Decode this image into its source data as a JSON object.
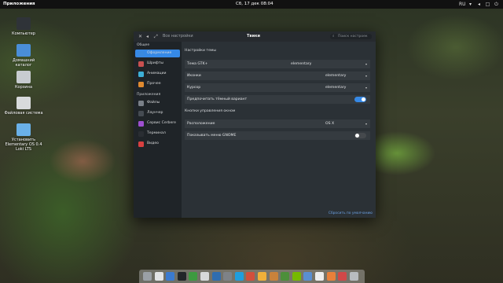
{
  "panel": {
    "applications_label": "Приложения",
    "clock": "Сб, 17 дек  08:04",
    "indicators": [
      {
        "name": "keyboard-layout-icon",
        "text": "RU"
      },
      {
        "name": "network-icon",
        "text": "▾"
      },
      {
        "name": "volume-icon",
        "text": "◂"
      },
      {
        "name": "notifications-icon",
        "text": "□"
      },
      {
        "name": "power-icon",
        "text": "⏻"
      }
    ]
  },
  "desktop": {
    "icons": [
      {
        "name": "computer",
        "label": "Компьютер",
        "color": "#2f3338"
      },
      {
        "name": "home-folder",
        "label": "Домашний каталог",
        "color": "#4a8ed8"
      },
      {
        "name": "trash",
        "label": "Корзина",
        "color": "#c8ccd0"
      },
      {
        "name": "filesystem",
        "label": "Файловая система",
        "color": "#d8dadc"
      },
      {
        "name": "installer",
        "label": "Установить Elementary OS 0.4 Loki LTS",
        "color": "#6ab0e8"
      }
    ]
  },
  "window": {
    "breadcrumb": "Все настройки",
    "title": "Твики",
    "search_placeholder": "Поиск настроек",
    "restore_link": "Сбросить по умолчанию"
  },
  "sidebar": {
    "groups": [
      {
        "label": "Общее",
        "items": [
          {
            "label": "Оформление",
            "icon": "appearance-icon",
            "color": "#3a8ae0",
            "selected": true
          },
          {
            "label": "Шрифты",
            "icon": "fonts-icon",
            "color": "#c85050"
          },
          {
            "label": "Анимации",
            "icon": "animations-icon",
            "color": "#3db0d8"
          },
          {
            "label": "Прочее",
            "icon": "misc-icon",
            "color": "#e08a30"
          }
        ]
      },
      {
        "label": "Приложения",
        "items": [
          {
            "label": "Файлы",
            "icon": "files-icon",
            "color": "#7a8088"
          },
          {
            "label": "Лаунчер",
            "icon": "launcher-icon",
            "color": "#454b52"
          },
          {
            "label": "Сервис Cerbere",
            "icon": "cerbere-icon",
            "color": "#9e4fd0"
          },
          {
            "label": "Терминал",
            "icon": "terminal-icon",
            "color": "#2a2e33"
          },
          {
            "label": "Видео",
            "icon": "videos-icon",
            "color": "#d84040"
          }
        ]
      }
    ]
  },
  "theme_settings": {
    "section_title": "Настройки темы",
    "rows": [
      {
        "label": "Тема GTK+",
        "value": "elementary"
      },
      {
        "label": "Иконки",
        "value": "elementary"
      },
      {
        "label": "Курсор",
        "value": "elementary"
      }
    ],
    "dark_variant": {
      "label": "Предпочитать тёмный вариант",
      "on": true
    }
  },
  "window_controls": {
    "section_title": "Кнопки управления окном",
    "layout": {
      "label": "Расположение",
      "value": "OS X"
    },
    "gnome_menu": {
      "label": "Показывать меню GNOME",
      "on": false
    }
  },
  "colors": {
    "accent": "#3689e6",
    "toggle_off": "#45494d"
  },
  "dock": {
    "items": [
      {
        "name": "files",
        "color": "#9aa0a6"
      },
      {
        "name": "appcenter",
        "color": "#e2e4e6"
      },
      {
        "name": "system-monitor",
        "color": "#3a7ad0"
      },
      {
        "name": "terminal",
        "color": "#222629"
      },
      {
        "name": "code-editor",
        "color": "#3d9a40"
      },
      {
        "name": "screenshot",
        "color": "#d7d9db"
      },
      {
        "name": "web-browser",
        "color": "#2f6db0"
      },
      {
        "name": "settings",
        "color": "#7e8287"
      },
      {
        "name": "skype",
        "color": "#1f9ede"
      },
      {
        "name": "chrome",
        "color": "#d24f3c"
      },
      {
        "name": "downloads",
        "color": "#f0b03a"
      },
      {
        "name": "photos",
        "color": "#c9823b"
      },
      {
        "name": "android-studio",
        "color": "#4d8f3a"
      },
      {
        "name": "nvidia",
        "color": "#76b900"
      },
      {
        "name": "mail",
        "color": "#5a8fd0"
      },
      {
        "name": "calendar",
        "color": "#eeeeee"
      },
      {
        "name": "music",
        "color": "#e8803a"
      },
      {
        "name": "videos",
        "color": "#d04848"
      },
      {
        "name": "trash",
        "color": "#b8bcc0"
      }
    ]
  }
}
